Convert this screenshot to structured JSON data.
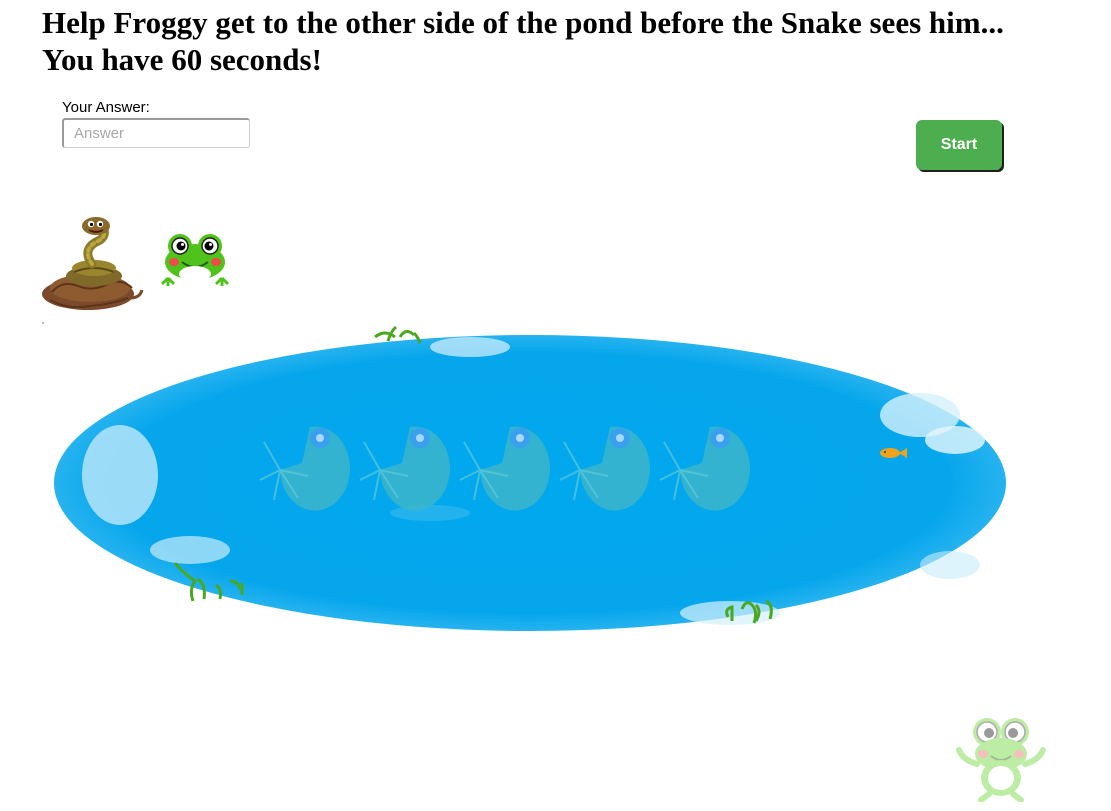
{
  "header": {
    "line1": "Help Froggy get to the other side of the pond before the Snake sees him...",
    "line2": "You have 60 seconds!"
  },
  "answer": {
    "label": "Your Answer:",
    "placeholder": "Answer",
    "value": ""
  },
  "start_button": {
    "label": "Start"
  },
  "icons": {
    "snake": "snake-icon",
    "frog": "frog-icon",
    "pond": "pond-icon",
    "lily_pad": "lily-pad-icon",
    "fish": "fish-icon",
    "goal_frog": "goal-frog-icon"
  },
  "colors": {
    "start_button": "#4cae4f",
    "pond_water": "#03a9f0",
    "lily_pad": "#3cb5c9",
    "frog_green": "#4fc31a",
    "fish": "#f0a21a"
  },
  "lily_pads": [
    {
      "id": 1
    },
    {
      "id": 2
    },
    {
      "id": 3
    },
    {
      "id": 4
    },
    {
      "id": 5
    }
  ]
}
